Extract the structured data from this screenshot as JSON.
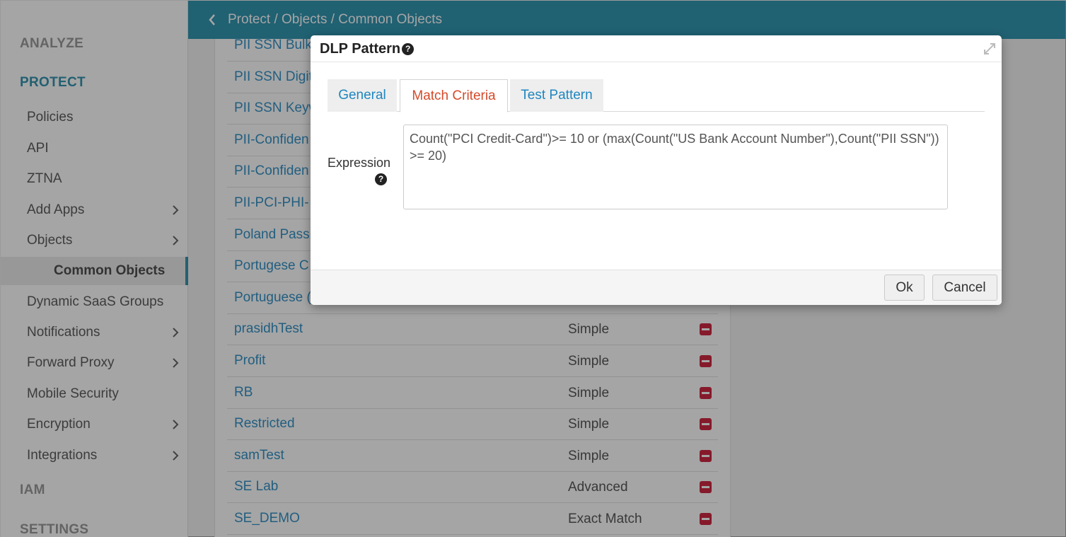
{
  "header": {
    "breadcrumb": "Protect / Objects / Common Objects"
  },
  "sidebar": {
    "sections": {
      "analyze": "ANALYZE",
      "protect": "PROTECT",
      "iam": "IAM",
      "settings": "SETTINGS"
    },
    "items": [
      {
        "label": "Policies"
      },
      {
        "label": "API"
      },
      {
        "label": "ZTNA"
      },
      {
        "label": "Add Apps"
      },
      {
        "label": "Objects"
      },
      {
        "label": "Common Objects"
      },
      {
        "label": "Dynamic SaaS Groups"
      },
      {
        "label": "Notifications"
      },
      {
        "label": "Forward Proxy"
      },
      {
        "label": "Mobile Security"
      },
      {
        "label": "Encryption"
      },
      {
        "label": "Integrations"
      }
    ]
  },
  "list": {
    "rows": [
      {
        "name": "PII SSN Bulk",
        "type": ""
      },
      {
        "name": "PII SSN Digit",
        "type": ""
      },
      {
        "name": "PII SSN Keyw",
        "type": ""
      },
      {
        "name": "PII-Confiden",
        "type": ""
      },
      {
        "name": "PII-Confiden",
        "type": ""
      },
      {
        "name": "PII-PCI-PHI-",
        "type": ""
      },
      {
        "name": "Poland Pass",
        "type": ""
      },
      {
        "name": "Portugese C",
        "type": ""
      },
      {
        "name": "Portuguese (",
        "type": ""
      },
      {
        "name": "prasidhTest",
        "type": "Simple"
      },
      {
        "name": "Profit",
        "type": "Simple"
      },
      {
        "name": "RB",
        "type": "Simple"
      },
      {
        "name": "Restricted",
        "type": "Simple"
      },
      {
        "name": "samTest",
        "type": "Simple"
      },
      {
        "name": "SE Lab",
        "type": "Advanced"
      },
      {
        "name": "SE_DEMO",
        "type": "Exact Match"
      }
    ]
  },
  "modal": {
    "title": "DLP Pattern",
    "tabs": {
      "general": "General",
      "match": "Match Criteria",
      "test": "Test Pattern"
    },
    "expression_label": "Expression",
    "expression_value": "Count(\"PCI Credit-Card\")>= 10 or (max(Count(\"US Bank Account Number\"),Count(\"PII SSN\")) >= 20)",
    "ok_label": "Ok",
    "cancel_label": "Cancel"
  },
  "colors": {
    "accent": "#1a8aa8",
    "link": "#1e86c0",
    "active_tab": "#d64a2a",
    "delete": "#c8102e"
  }
}
